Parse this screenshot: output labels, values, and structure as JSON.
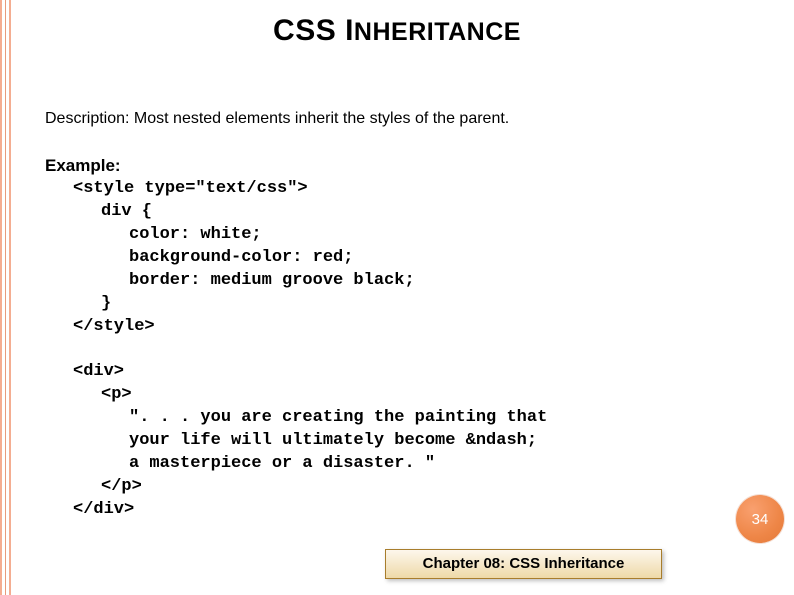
{
  "title": {
    "strong": "CSS I",
    "smallcaps": "NHERITANCE"
  },
  "description": "Description: Most nested elements inherit the styles of the parent.",
  "example": {
    "label": "Example:",
    "code_lines": [
      {
        "indent": 1,
        "text": "<style type=\"text/css\">"
      },
      {
        "indent": 2,
        "text": "div {"
      },
      {
        "indent": 3,
        "text": "color: white;"
      },
      {
        "indent": 3,
        "text": "background-color: red;"
      },
      {
        "indent": 3,
        "text": "border: medium groove black;"
      },
      {
        "indent": 2,
        "text": "}"
      },
      {
        "indent": 1,
        "text": "</style>"
      },
      {
        "indent": 1,
        "text": ""
      },
      {
        "indent": 1,
        "text": "<div>"
      },
      {
        "indent": 2,
        "text": "<p>"
      },
      {
        "indent": 3,
        "text": "\". . . you are creating the painting that"
      },
      {
        "indent": 3,
        "text": "your life will ultimately become &ndash;"
      },
      {
        "indent": 3,
        "text": "a masterpiece or a disaster. \""
      },
      {
        "indent": 2,
        "text": "</p>"
      },
      {
        "indent": 1,
        "text": "</div>"
      }
    ]
  },
  "chapter_label": "Chapter  08: CSS Inheritance",
  "page_number": "34"
}
